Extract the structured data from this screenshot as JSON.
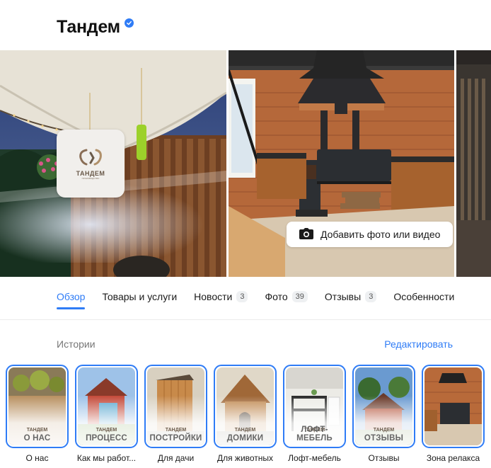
{
  "header": {
    "title": "Тандем",
    "verified_icon": "verified-badge-icon"
  },
  "logo": {
    "name": "ТАНДЕМ",
    "tagline": "ПРОИЗВОДСТВО"
  },
  "gallery": {
    "add_photo_label": "Добавить фото или видео",
    "add_photo_icon": "camera-icon"
  },
  "tabs": [
    {
      "label": "Обзор",
      "count": null,
      "active": true
    },
    {
      "label": "Товары и услуги",
      "count": null
    },
    {
      "label": "Новости",
      "count": "3"
    },
    {
      "label": "Фото",
      "count": "39"
    },
    {
      "label": "Отзывы",
      "count": "3"
    },
    {
      "label": "Особенности",
      "count": null
    }
  ],
  "stories_section": {
    "title": "Истории",
    "edit_label": "Редактировать"
  },
  "stories": [
    {
      "badge": "О НАС",
      "label": "О нас",
      "logo": "ТАНДЕМ"
    },
    {
      "badge": "ПРОЦЕСС",
      "label": "Как мы работ...",
      "logo": "ТАНДЕМ"
    },
    {
      "badge": "ПОСТРОЙКИ",
      "label": "Для дачи",
      "logo": "ТАНДЕМ"
    },
    {
      "badge": "ДОМИКИ",
      "label": "Для животных",
      "logo": "ТАНДЕМ"
    },
    {
      "badge": "ЛОФТ-МЕБЕЛЬ",
      "label": "Лофт-мебель",
      "logo": "ТАНДЕМ"
    },
    {
      "badge": "ОТЗЫВЫ",
      "label": "Отзывы",
      "logo": "ТАНДЕМ"
    },
    {
      "badge": "",
      "label": "Зона релакса",
      "logo": ""
    }
  ],
  "colors": {
    "accent": "#2f7cf6",
    "wood": "#a0582a",
    "dark": "#1e1e22"
  }
}
